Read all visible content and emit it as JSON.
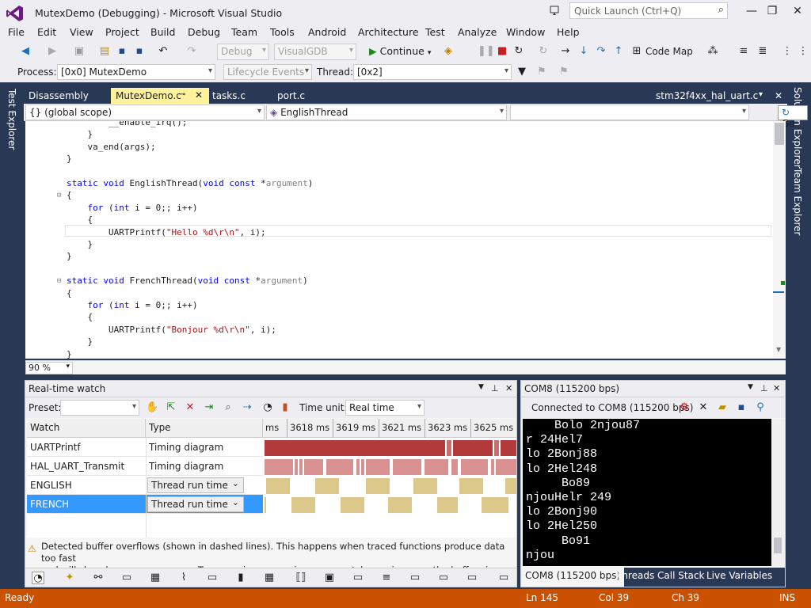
{
  "window": {
    "title": "MutexDemo (Debugging) - Microsoft Visual Studio",
    "quick_launch_placeholder": "Quick Launch (Ctrl+Q)",
    "minimize": "—",
    "maximize": "❐",
    "close": "✕"
  },
  "menu": [
    "File",
    "Edit",
    "View",
    "Project",
    "Build",
    "Debug",
    "Team",
    "Tools",
    "Android",
    "Architecture",
    "Test",
    "Analyze",
    "Window",
    "Help"
  ],
  "toolbar": {
    "config": "Debug",
    "platform": "VisualGDB",
    "continue": "Continue",
    "codemap": "Code Map"
  },
  "debugbar": {
    "process_label": "Process:",
    "process_value": "[0x0] MutexDemo",
    "lifecycle": "Lifecycle Events",
    "thread_label": "Thread:",
    "thread_value": "[0x2]"
  },
  "side_tabs": {
    "left": "Test Explorer",
    "right1": "Solution Explorer",
    "right2": "Team Explorer"
  },
  "doc_tabs": [
    "Disassembly",
    "MutexDemo.c",
    "tasks.c",
    "port.c"
  ],
  "doc_tab_right": "stm32f4xx_hal_uart.c",
  "navbar": {
    "scope": "{} (global scope)",
    "member": "EnglishThread",
    "extra": "",
    "go": "Go"
  },
  "code": [
    "        __enable_irq();",
    "    }",
    "    va_end(args);",
    "}",
    "",
    "static void EnglishThread(void const *argument)",
    "{",
    "    for (int i = 0;; i++)",
    "    {",
    "        UARTPrintf(\"Hello %d\\r\\n\", i);",
    "    }",
    "}",
    "",
    "static void FrenchThread(void const *argument)",
    "{",
    "    for (int i = 0;; i++)",
    "    {",
    "        UARTPrintf(\"Bonjour %d\\r\\n\", i);",
    "    }",
    "}"
  ],
  "editor": {
    "zoom": "90 %"
  },
  "rtw": {
    "title": "Real-time watch",
    "preset_label": "Preset:",
    "time_unit_label": "Time unit:",
    "time_unit_value": "Real time",
    "col_watch": "Watch",
    "col_type": "Type",
    "ticks": [
      "ms",
      "3618 ms",
      "3619 ms",
      "3621 ms",
      "3623 ms",
      "3625 ms"
    ],
    "rows": [
      {
        "name": "UARTPrintf",
        "type": "Timing diagram",
        "selector": false
      },
      {
        "name": "HAL_UART_Transmit",
        "type": "Timing diagram",
        "selector": false
      },
      {
        "name": "ENGLISH",
        "type": "Thread run time",
        "selector": true
      },
      {
        "name": "FRENCH",
        "type": "Thread run time",
        "selector": true
      }
    ],
    "warning_line1": "Detected buffer overflows (shown in dashed lines). This happens when traced functions produce data too fast",
    "warning_line2": "and will slow down your program. Try removing or pausing some watches or increase the buffer size.",
    "colors": {
      "uart": "#b33a3a",
      "hal": "#d89090",
      "thread": "#dcc88a",
      "selected": "#3399ff"
    }
  },
  "com": {
    "title": "COM8 (115200 bps)",
    "connected": "Connected to COM8 (115200 bps)",
    "lines": [
      "    Bolo 2njou87",
      "r 24Hel7",
      "lo 2Bonj88",
      "lo 2Hel248",
      "     Bo89",
      "njouHelr 249",
      "lo 2Bonj90",
      "lo 2Hel250",
      "     Bo91",
      "njou"
    ],
    "tabs": [
      "COM8 (115200 bps)",
      "Threads",
      "Call Stack",
      "Live Variables"
    ]
  },
  "status": {
    "state": "Ready",
    "ln": "Ln 145",
    "col": "Col 39",
    "ch": "Ch 39",
    "mode": "INS"
  }
}
